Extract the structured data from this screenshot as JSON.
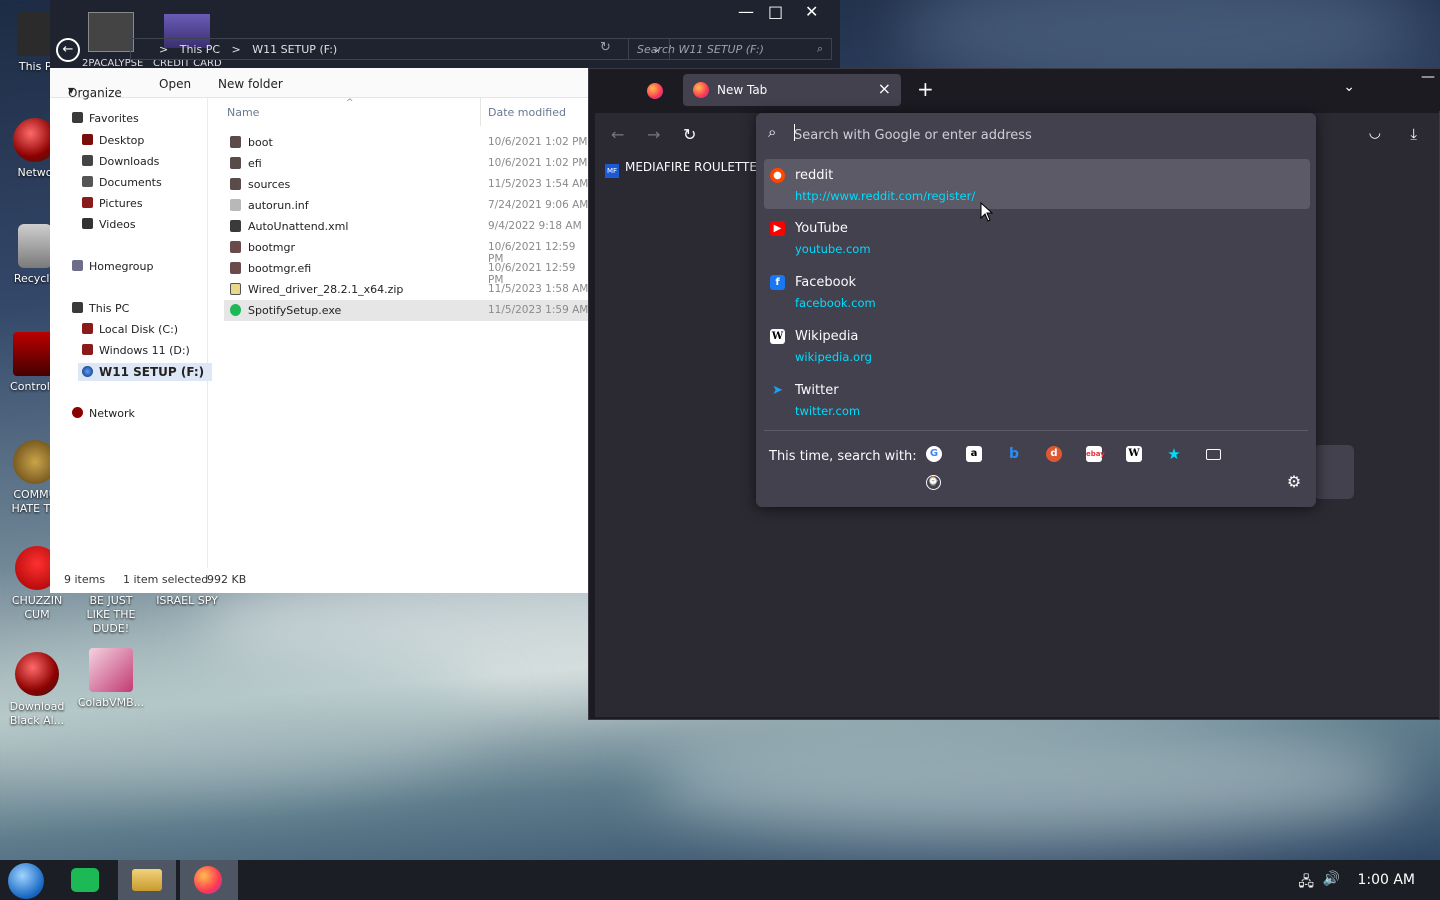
{
  "desktop": {
    "icons": [
      {
        "label": "This PC"
      },
      {
        "label": "Netwo"
      },
      {
        "label": "Recycle"
      },
      {
        "label": "Control P"
      },
      {
        "label": "COMMU HATE TH"
      },
      {
        "label": "CHUZZIN CUM"
      },
      {
        "label": "BE JUST LIKE THE DUDE!"
      },
      {
        "label": "ISRAEL SPY"
      },
      {
        "label": "Download Black Al..."
      },
      {
        "label": "ColabVMB..."
      },
      {
        "label": "2PACALYPSE"
      },
      {
        "label": "CREDIT CARD"
      }
    ]
  },
  "explorer": {
    "breadcrumb": [
      ">",
      "This PC",
      ">",
      "W11 SETUP (F:)"
    ],
    "search_placeholder": "Search W11 SETUP (F:)",
    "toolbar": {
      "organize": "Organize",
      "open": "Open",
      "new_folder": "New folder"
    },
    "nav": {
      "favorites": "Favorites",
      "fav_items": [
        "Desktop",
        "Downloads",
        "Documents",
        "Pictures",
        "Videos"
      ],
      "homegroup": "Homegroup",
      "this_pc": "This PC",
      "pc_items": [
        "Local Disk (C:)",
        "Windows 11 (D:)",
        "W11 SETUP (F:)"
      ],
      "network": "Network"
    },
    "columns": {
      "name": "Name",
      "date": "Date modified"
    },
    "files": [
      {
        "name": "boot",
        "date": "10/6/2021 1:02 PM"
      },
      {
        "name": "efi",
        "date": "10/6/2021 1:02 PM"
      },
      {
        "name": "sources",
        "date": "11/5/2023 1:54 AM"
      },
      {
        "name": "autorun.inf",
        "date": "7/24/2021 9:06 AM"
      },
      {
        "name": "AutoUnattend.xml",
        "date": "9/4/2022 9:18 AM"
      },
      {
        "name": "bootmgr",
        "date": "10/6/2021 12:59 PM"
      },
      {
        "name": "bootmgr.efi",
        "date": "10/6/2021 12:59 PM"
      },
      {
        "name": "Wired_driver_28.2.1_x64.zip",
        "date": "11/5/2023 1:58 AM"
      },
      {
        "name": "SpotifySetup.exe",
        "date": "11/5/2023 1:59 AM"
      }
    ],
    "status": {
      "count": "9 items",
      "selected": "1 item selected",
      "size": "992 KB"
    },
    "window_controls": {
      "minimize": "—",
      "maximize": "□",
      "close": "✕"
    }
  },
  "firefox": {
    "tab_title": "New Tab",
    "tab_close": "×",
    "new_tab": "+",
    "bookmark": "MEDIAFIRE ROULETTER",
    "bookmark_icon_text": "MF",
    "urlbar": {
      "placeholder": "Search with Google or enter address",
      "suggestions": [
        {
          "title": "reddit",
          "url": "http://www.reddit.com/register/"
        },
        {
          "title": "YouTube",
          "url": "youtube.com"
        },
        {
          "title": "Facebook",
          "url": "facebook.com"
        },
        {
          "title": "Wikipedia",
          "url": "wikipedia.org"
        },
        {
          "title": "Twitter",
          "url": "twitter.com"
        }
      ],
      "search_with_label": "This time, search with:",
      "engine_icons": [
        "google-icon",
        "amazon-icon",
        "bing-icon",
        "duckduckgo-icon",
        "ebay-icon",
        "wikipedia-icon",
        "bookmarks-star-icon",
        "tabs-icon",
        "history-icon"
      ]
    },
    "colors": {
      "accent_link": "#00ddff",
      "bg": "#2b2a33",
      "panel": "#42414d"
    }
  },
  "taskbar": {
    "clock": "1:00 AM"
  }
}
